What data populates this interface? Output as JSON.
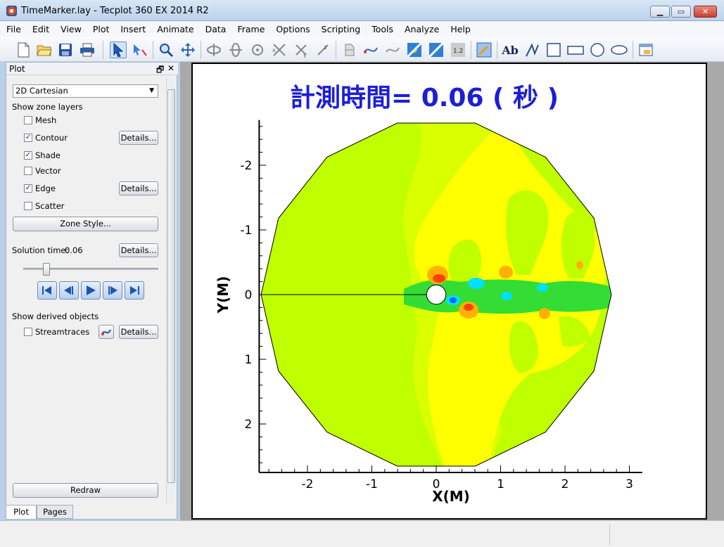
{
  "window": {
    "title": "TimeMarker.lay - Tecplot 360 EX 2014 R2"
  },
  "menu": [
    "File",
    "Edit",
    "View",
    "Plot",
    "Insert",
    "Animate",
    "Data",
    "Frame",
    "Options",
    "Scripting",
    "Tools",
    "Analyze",
    "Help"
  ],
  "toolbar": {
    "icons": [
      "new-layout-icon",
      "open-layout-icon",
      "save-icon",
      "print-icon",
      "select-arrow-icon",
      "adjustor-arrow-icon",
      "zoom-icon",
      "translate-icon",
      "rotate-x-icon",
      "rotate-y-icon",
      "rotate-z-icon",
      "rotate-xy-icon",
      "spherical-rotate-icon",
      "roller-ball-icon",
      "slice-icon",
      "streamtrace-icon",
      "extract-icon",
      "add-contour-level-icon",
      "remove-contour-level-icon",
      "contour-label-icon",
      "probe-icon",
      "text-icon",
      "polyline-icon",
      "square-icon",
      "rectangle-icon",
      "circle-icon",
      "ellipse-icon",
      "frame-icon"
    ],
    "text_tool_label": "Ab"
  },
  "sidebar": {
    "header": "Plot",
    "plot_type": "2D Cartesian",
    "show_zone_layers_label": "Show zone layers",
    "layers": [
      {
        "label": "Mesh",
        "checked": false,
        "details": false
      },
      {
        "label": "Contour",
        "checked": true,
        "details": true
      },
      {
        "label": "Shade",
        "checked": true,
        "details": false
      },
      {
        "label": "Vector",
        "checked": false,
        "details": false
      },
      {
        "label": "Edge",
        "checked": true,
        "details": true
      },
      {
        "label": "Scatter",
        "checked": false,
        "details": false
      }
    ],
    "details_label": "Details...",
    "zone_style_label": "Zone Style...",
    "solution_time_label": "Solution time:",
    "solution_time_value": "0.06",
    "slider_fraction": 0.2,
    "show_derived_label": "Show derived objects",
    "streamtraces_label": "Streamtraces",
    "redraw_label": "Redraw",
    "tabs": [
      "Plot",
      "Pages"
    ]
  },
  "plot": {
    "title": "計測時間= 0.06 ( 秒 )",
    "title_color": "#1c1fd6",
    "xlabel": "X(M)",
    "ylabel": "Y(M)",
    "x_ticks": [
      "-2",
      "-1",
      "0",
      "1",
      "2",
      "3"
    ],
    "y_ticks": [
      "2",
      "1",
      "0",
      "-1",
      "-2"
    ]
  },
  "chart_data": {
    "type": "heatmap",
    "title": "計測時間= 0.06 ( 秒 )",
    "xlabel": "X(M)",
    "ylabel": "Y(M)",
    "xlim": [
      -2.75,
      3.2
    ],
    "ylim": [
      -2.75,
      2.7
    ],
    "x_ticks": [
      -2,
      -1,
      0,
      1,
      2,
      3
    ],
    "y_ticks": [
      -2,
      -1,
      0,
      1,
      2
    ],
    "domain_radius": 2.72,
    "cylinder_radius": 0.15,
    "colors": {
      "background": "#bfff00",
      "light": "#d9ff00",
      "high": "#ffff00",
      "orange": "#ffb000",
      "red": "#ff4000",
      "green": "#33dd33",
      "cyan": "#00e0ff",
      "blue": "#0060ff"
    }
  }
}
